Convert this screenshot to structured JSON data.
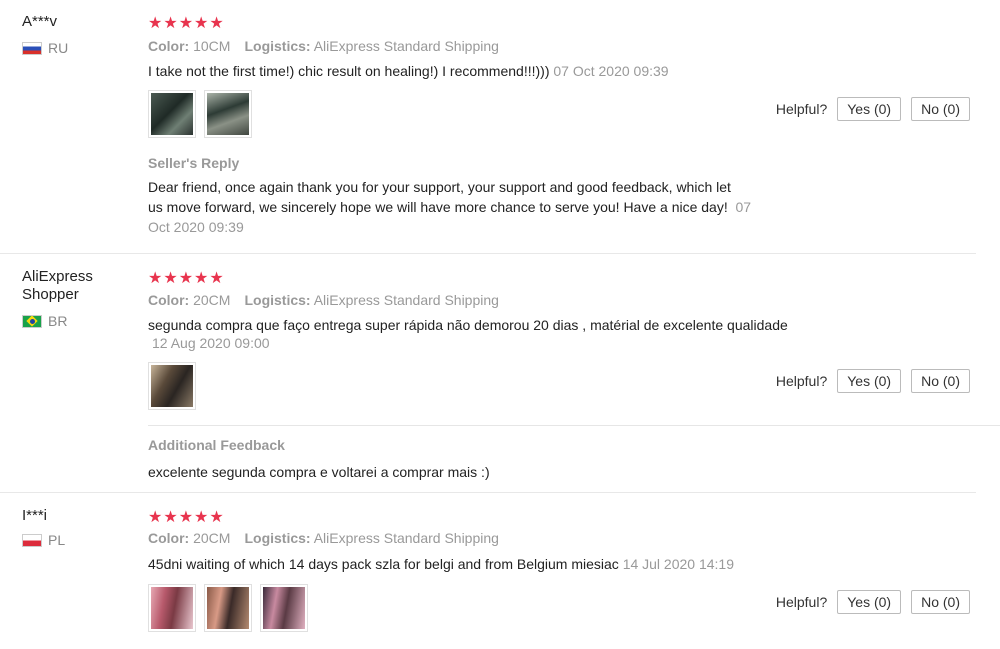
{
  "labels": {
    "color": "Color:",
    "logistics": "Logistics:",
    "helpful": "Helpful?",
    "seller_reply": "Seller's Reply",
    "additional_feedback": "Additional Feedback"
  },
  "icons": {
    "star": "★★★★★",
    "star_color": "#e8344e"
  },
  "reviews": [
    {
      "user": "A***v",
      "country": "RU",
      "color_value": "10CM",
      "logistics_value": "AliExpress Standard Shipping",
      "text": "I take not the first time!) chic result on healing!) I recommend!!!)))",
      "date": "07 Oct 2020 09:39",
      "yes": "Yes (0)",
      "no": "No (0)",
      "seller_reply_line1": "Dear friend, once again thank you for your support, your support and good feedback, which let",
      "seller_reply_line2": "us move forward, we sincerely hope we will have more chance to serve you! Have a nice day!",
      "seller_reply_date_a": "07",
      "seller_reply_date_b": "Oct 2020 09:39"
    },
    {
      "user": "AliExpress Shopper",
      "country": "BR",
      "color_value": "20CM",
      "logistics_value": "AliExpress Standard Shipping",
      "text": "segunda compra que faço entrega super rápida não demorou 20 dias , matérial de excelente qualidade",
      "date": "12 Aug 2020 09:00",
      "yes": "Yes (0)",
      "no": "No (0)",
      "additional_text": "excelente segunda compra e voltarei a comprar mais :)"
    },
    {
      "user": "I***i",
      "country": "PL",
      "color_value": "20CM",
      "logistics_value": "AliExpress Standard Shipping",
      "text": "45dni waiting of which 14 days pack szla for belgi and from Belgium miesiac",
      "date": "14 Jul 2020 14:19",
      "yes": "Yes (0)",
      "no": "No (0)"
    }
  ]
}
